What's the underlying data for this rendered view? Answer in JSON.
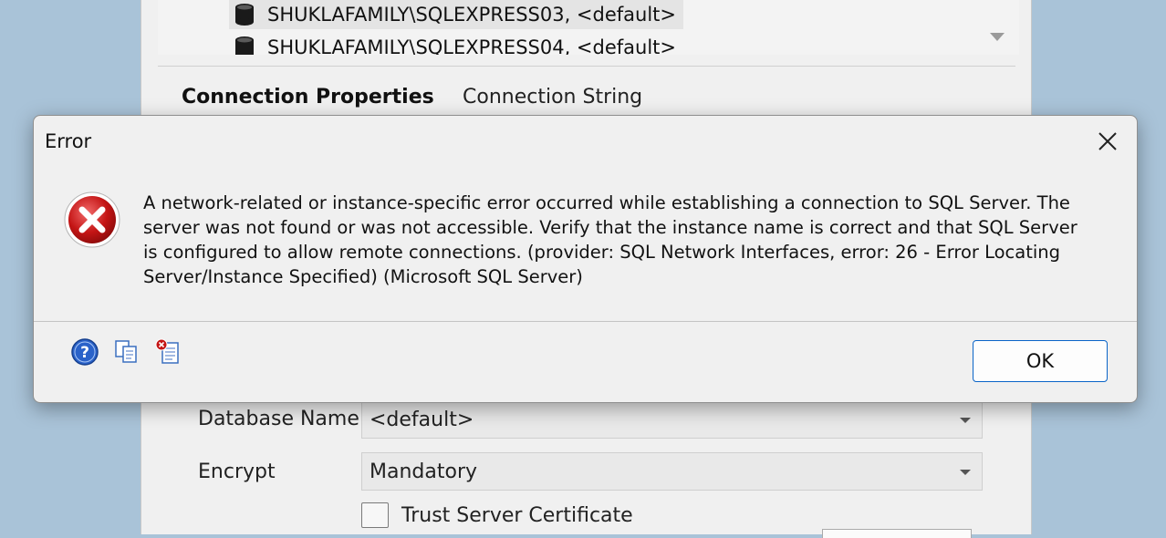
{
  "background_window": {
    "servers": [
      "SHUKLAFAMILY\\SQLEXPRESS03, <default>",
      "SHUKLAFAMILY\\SQLEXPRESS04, <default>"
    ],
    "tabs": [
      "Connection Properties",
      "Connection String"
    ],
    "database_name": {
      "label": "Database Name",
      "value": "<default>"
    },
    "encrypt": {
      "label": "Encrypt",
      "value": "Mandatory"
    },
    "trust_server_certificate": {
      "label": "Trust Server Certificate",
      "checked": false
    }
  },
  "error_dialog": {
    "title": "Error",
    "message": "A network-related or instance-specific error occurred while establishing a connection to SQL Server. The server was not found or was not accessible. Verify that the instance name is correct and that SQL Server is configured to allow remote connections. (provider: SQL Network Interfaces, error: 26 - Error Locating Server/Instance Specified) (Microsoft SQL Server)",
    "ok_label": "OK",
    "icons": [
      "error-icon",
      "help-icon",
      "copy-icon",
      "details-icon"
    ]
  }
}
